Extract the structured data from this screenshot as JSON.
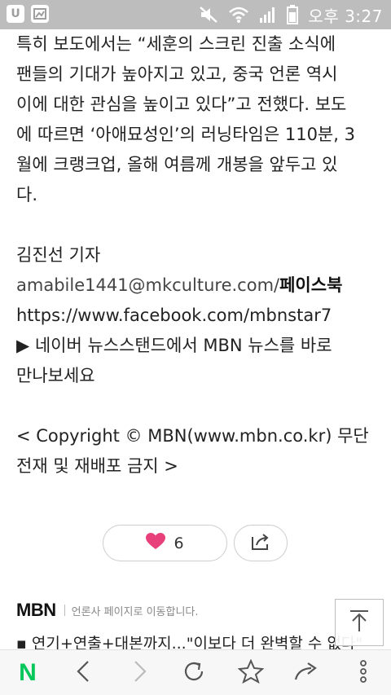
{
  "status_bar": {
    "left_icons": [
      "u-plus-icon",
      "gallery-icon"
    ],
    "time": "오후 3:27"
  },
  "article": {
    "lines": [
      "특히 보도에서는 “세훈의 스크린 진출 소식에",
      "팬들의 기대가 높아지고 있고, 중국 언론 역시",
      "이에 대한 관심을 높이고 있다”고 전했다. 보도",
      "에 따르면 ‘아애묘성인’의 러닝타임은 110분, 3",
      "월에 크랭크업, 올해 여름께 개봉을 앞두고 있",
      "다."
    ],
    "reporter": "김진선 기자",
    "email": "amabile1441@mkculture.com/",
    "facebook_label": "페이스북",
    "facebook_url": "https://www.facebook.com/mbnstar7",
    "promo_line1": "▶ 네이버 뉴스스탠드에서 MBN 뉴스를 바로",
    "promo_line2": "만나보세요",
    "copyright_line1": "< Copyright © MBN(www.mbn.co.kr) 무단",
    "copyright_line2": "전재 및 재배포 금지 >"
  },
  "actions": {
    "like_count": "6"
  },
  "press": {
    "logo": "MBN",
    "link_text": "언론사 페이지로 이동합니다.",
    "headline": "▪ 연기+연출+대본까지...\"이보다 더 완벽할 수 없다\""
  },
  "toolbar": {
    "naver_logo": "N"
  },
  "colors": {
    "status_bar": "#bdbdbd",
    "heart": "#e8407a",
    "naver_green": "#03c75a"
  }
}
